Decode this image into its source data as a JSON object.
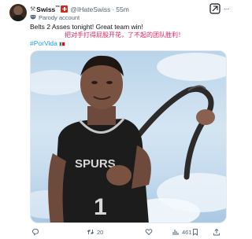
{
  "author": {
    "name": "Swiss",
    "name_suffix": "™",
    "handle": "@IHateSwiss",
    "separator": "·",
    "time": "55m",
    "parody_label": "Parody account"
  },
  "tweet": {
    "line1": "Belts 2 Asses tonight! Great team win!",
    "line2": "把对手打得屁股开花，了不起的团队胜利！",
    "hashtag": "#PorVida"
  },
  "media": {
    "jersey_text": "SPURS",
    "jersey_number": "1"
  },
  "actions": {
    "reply_count": "",
    "retweet_count": "20",
    "like_count": "",
    "views_count": "461",
    "bookmark_count": "",
    "share_count": ""
  },
  "icons": {
    "header_emoji": "tools-emoji",
    "flag": "swiss-flag",
    "grok": "grok-icon",
    "more": "more-icon",
    "parody": "mask-icon",
    "hashtag_emoji": "mexico-flag-emoji"
  },
  "colors": {
    "hashtag": "#1d9bf0",
    "chinese_text": "#e0245e",
    "muted": "#536471"
  }
}
